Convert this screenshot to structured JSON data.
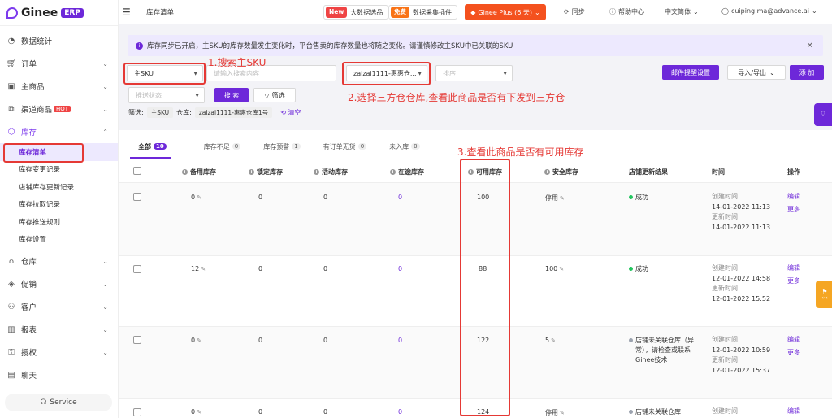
{
  "brand": {
    "name": "Ginee",
    "badge": "ERP"
  },
  "sidebar": {
    "items": [
      {
        "label": "数据统计",
        "icon": "dashboard-icon"
      },
      {
        "label": "订单",
        "icon": "cart-icon"
      },
      {
        "label": "主商品",
        "icon": "product-icon"
      },
      {
        "label": "渠道商品",
        "icon": "channel-icon",
        "badge": "HOT"
      },
      {
        "label": "库存",
        "icon": "inventory-icon"
      },
      {
        "label": "仓库",
        "icon": "warehouse-icon"
      },
      {
        "label": "促销",
        "icon": "tag-icon"
      },
      {
        "label": "客户",
        "icon": "customers-icon"
      },
      {
        "label": "报表",
        "icon": "chart-icon"
      },
      {
        "label": "授权",
        "icon": "auth-icon"
      },
      {
        "label": "聊天",
        "icon": "chat-icon"
      }
    ],
    "inventory_sub": [
      "库存清单",
      "库存变更记录",
      "店铺库存更新记录",
      "库存拉取记录",
      "库存推送规则",
      "库存设置"
    ],
    "service": "Service"
  },
  "topbar": {
    "crumb": "库存清单",
    "new_tag": "New",
    "new_label": "大数据选品",
    "free_tag": "免费",
    "free_label": "数据采集插件",
    "plus": "Ginee Plus (6 天)",
    "sync": "同步",
    "help": "帮助中心",
    "lang": "中文简体",
    "user": "cuiping.ma@advance.ai"
  },
  "notice": "库存同步已开启，主SKU的库存数量发生变化时，平台售卖的库存数量也将随之变化。请谨慎修改主SKU中已关联的SKU",
  "filters": {
    "sku_type": "主SKU",
    "search_placeholder": "请输入搜索内容",
    "warehouse": "zaizai1111-惠惠仓...",
    "sort_placeholder": "排序",
    "push_placeholder": "推送状态",
    "search_btn": "搜 索",
    "filter_btn": "筛选",
    "email_btn": "邮件提醒设置",
    "import_btn": "导入/导出",
    "add_btn": "添 加",
    "summary_label": "筛选:",
    "chip1": "主SKU",
    "warehouse_label": "仓库:",
    "chip2": "zaizai1111-惠惠仓库1号",
    "clear": "清空"
  },
  "annotations": {
    "a1": "1.搜索主SKU",
    "a2": "2.选择三方仓仓库,查看此商品是否有下发到三方仓",
    "a3": "3.查看此商品是否有可用库存"
  },
  "tabs": [
    {
      "label": "全部",
      "count": "10"
    },
    {
      "label": "库存不足",
      "count": "0"
    },
    {
      "label": "库存预警",
      "count": "1"
    },
    {
      "label": "有订单无货",
      "count": "0"
    },
    {
      "label": "未入库",
      "count": "0"
    }
  ],
  "columns": [
    "备用库存",
    "锁定库存",
    "活动库存",
    "在途库存",
    "可用库存",
    "安全库存",
    "店铺更新结果",
    "时间",
    "操作"
  ],
  "rows": [
    {
      "spare": "0",
      "locked": "0",
      "activity": "0",
      "transit": "0",
      "available": "100",
      "safety": "停用",
      "status": "成功",
      "created_label": "创建时间",
      "created": "14-01-2022 11:13",
      "updated_label": "更新时间",
      "updated": "14-01-2022 11:13",
      "edit": "编辑",
      "more": "更多"
    },
    {
      "spare": "12",
      "locked": "0",
      "activity": "0",
      "transit": "0",
      "available": "88",
      "safety": "100",
      "status": "成功",
      "created_label": "创建时间",
      "created": "12-01-2022 14:58",
      "updated_label": "更新时间",
      "updated": "12-01-2022 15:52",
      "edit": "编辑",
      "more": "更多"
    },
    {
      "spare": "0",
      "locked": "0",
      "activity": "0",
      "transit": "0",
      "available": "122",
      "safety": "5",
      "status": "店铺未关联仓库（异常），请检查或联系Ginee技术",
      "created_label": "创建时间",
      "created": "12-01-2022 10:59",
      "updated_label": "更新时间",
      "updated": "12-01-2022 15:37",
      "edit": "编辑",
      "more": "更多"
    },
    {
      "spare": "0",
      "locked": "0",
      "activity": "0",
      "transit": "0",
      "available": "124",
      "safety": "停用",
      "status": "店铺未关联仓库",
      "created_label": "创建时间",
      "created": "",
      "updated_label": "",
      "updated": "",
      "edit": "编辑",
      "more": ""
    }
  ],
  "colors": {
    "accent": "#6d28d9",
    "annotation": "#e53935",
    "success": "#22c55e",
    "warn": "#9ca3af",
    "plus": "#f4511e"
  }
}
